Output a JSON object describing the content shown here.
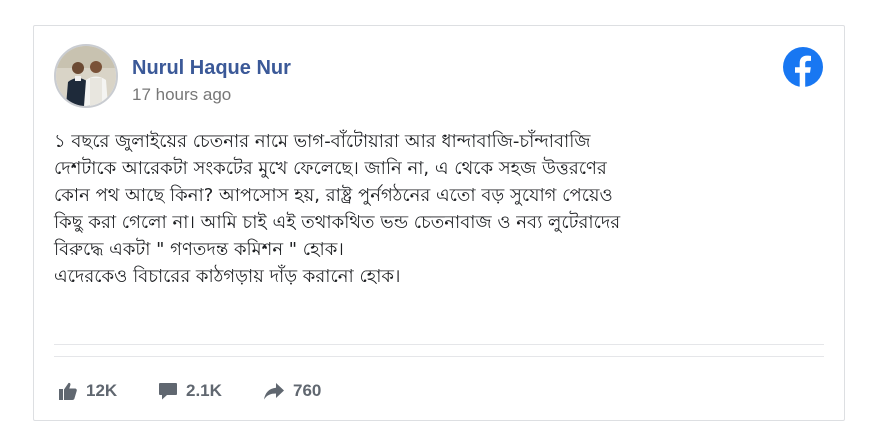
{
  "post": {
    "author": "Nurul Haque Nur",
    "timestamp": "17 hours ago",
    "body_lines": [
      "১ বছরে জুলাইয়ের চেতনার নামে ভাগ-বাঁটোয়ারা আর ধান্দাবাজি-চাঁন্দাবাজি",
      "দেশটাকে আরেকটা সংকটের মুখে ফেলেছে। জানি না, এ থেকে সহজ উত্তরণের",
      "কোন পথ আছে কিনা? আপসোস হয়, রাষ্ট্র পুর্নগঠনের এতো বড় সুযোগ পেয়েও",
      "কিছু করা গেলো না। আমি চাই এই তথাকথিত ভন্ড চেতনাবাজ ও নব্য লুটেরাদের",
      "বিরুদ্ধে একটা \" গণতদন্ত কমিশন \" হোক।",
      "এদেরকেও বিচারের কাঠগড়ায় দাঁড় করানো হোক।"
    ]
  },
  "stats": {
    "likes": "12K",
    "comments": "2.1K",
    "shares": "760"
  },
  "icons": {
    "brand": "facebook-logo-icon",
    "like": "thumbs-up-icon",
    "comment": "comment-bubble-icon",
    "share": "share-arrow-icon"
  },
  "colors": {
    "author": "#3b5998",
    "facebook_brand": "#1877f2",
    "meta_text": "#777777",
    "stat_text": "#606770",
    "body_text": "#1c1e21",
    "border": "#dddfe2"
  }
}
